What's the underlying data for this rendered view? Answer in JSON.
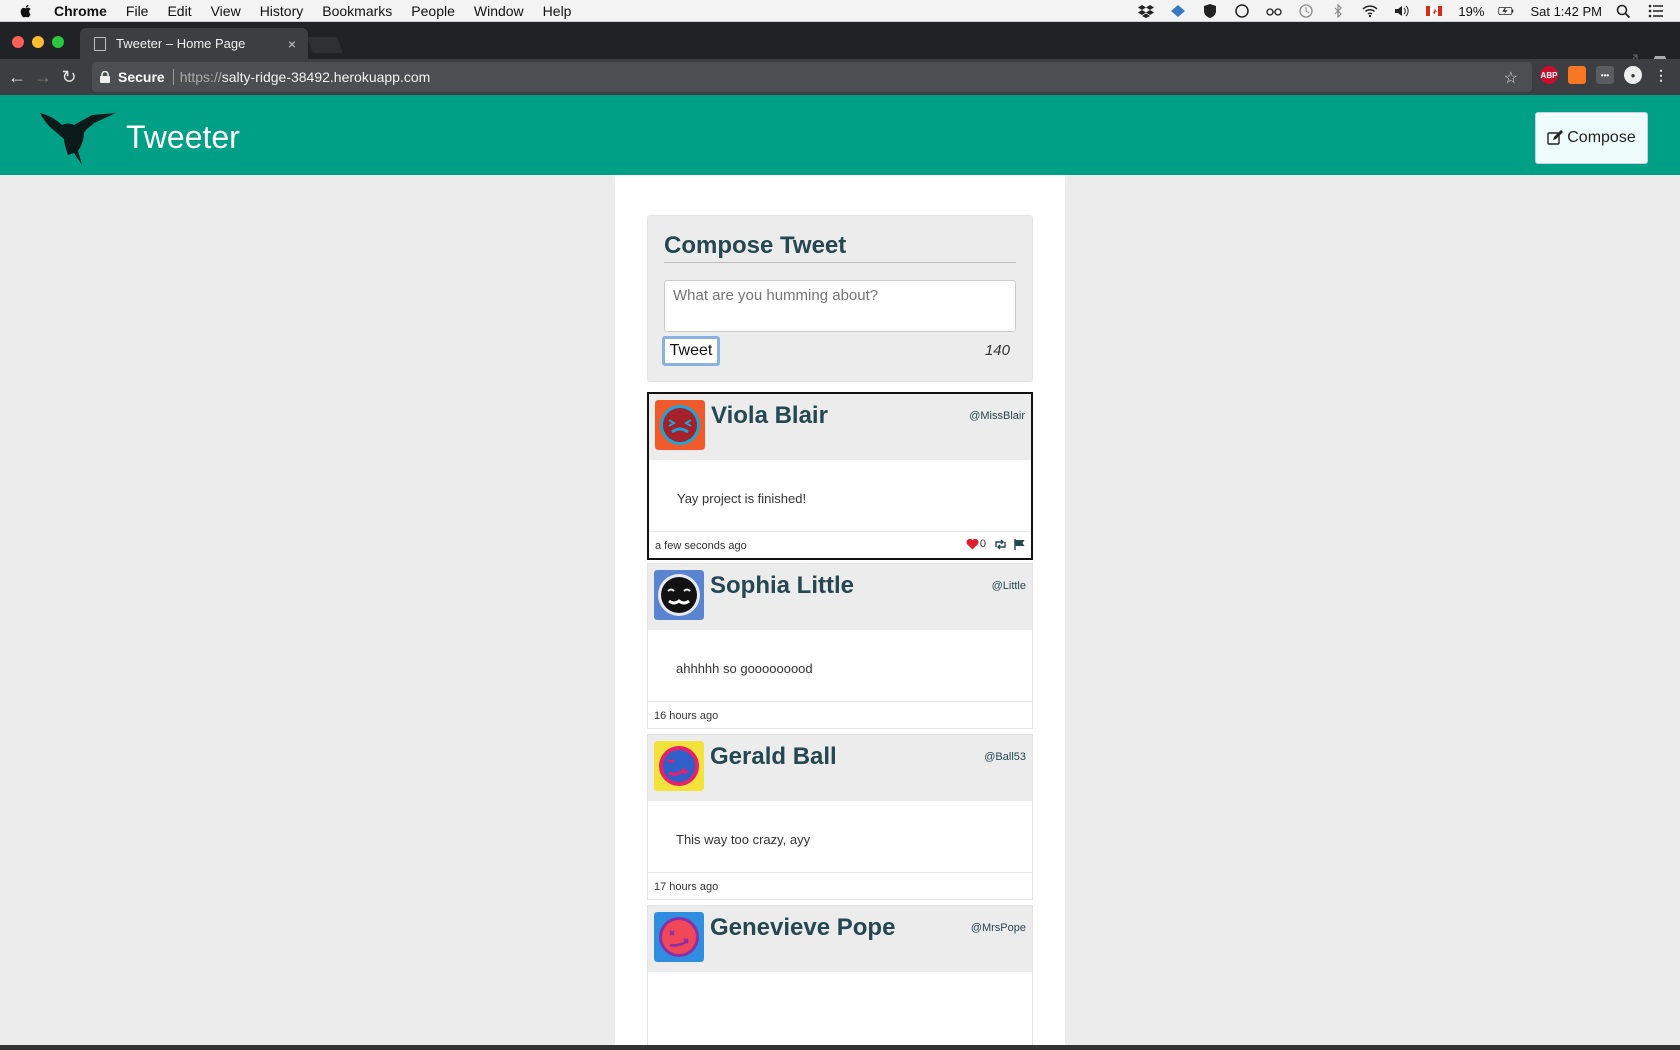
{
  "menubar": {
    "app": "Chrome",
    "items": [
      "File",
      "Edit",
      "View",
      "History",
      "Bookmarks",
      "People",
      "Window",
      "Help"
    ],
    "battery": "19%",
    "clock": "Sat 1:42 PM"
  },
  "browser": {
    "tab_title": "Tweeter – Home Page",
    "tab_close": "×",
    "secure_label": "Secure",
    "url_scheme": "https://",
    "url_host": "salty-ridge-38492.herokuapp.com",
    "ext_abp": "ABP"
  },
  "site": {
    "brand": "Tweeter",
    "compose_button": "Compose",
    "accent": "#00a087"
  },
  "compose": {
    "title": "Compose Tweet",
    "placeholder": "What are you humming about?",
    "submit_label": "Tweet",
    "counter": "140"
  },
  "tweets": [
    {
      "name": "Viola Blair",
      "handle": "@MissBlair",
      "content": "Yay project is finished!",
      "time": "a few seconds ago",
      "likes": "0"
    },
    {
      "name": "Sophia Little",
      "handle": "@Little",
      "content": "ahhhhh so gooooooood",
      "time": "16 hours ago"
    },
    {
      "name": "Gerald Ball",
      "handle": "@Ball53",
      "content": "This way too crazy, ayy",
      "time": "17 hours ago"
    },
    {
      "name": "Genevieve Pope",
      "handle": "@MrsPope"
    }
  ]
}
